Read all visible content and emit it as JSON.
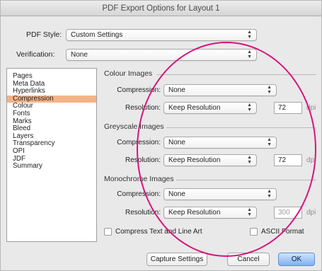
{
  "window": {
    "title": "PDF Export Options for Layout 1"
  },
  "pdf_style": {
    "label": "PDF Style:",
    "value": "Custom Settings"
  },
  "verification": {
    "label": "Verification:",
    "value": "None"
  },
  "sidebar": {
    "items": [
      {
        "label": "Pages"
      },
      {
        "label": "Meta Data"
      },
      {
        "label": "Hyperlinks"
      },
      {
        "label": "Compression",
        "selected": true
      },
      {
        "label": "Colour"
      },
      {
        "label": "Fonts"
      },
      {
        "label": "Marks"
      },
      {
        "label": "Bleed"
      },
      {
        "label": "Layers"
      },
      {
        "label": "Transparency"
      },
      {
        "label": "OPI"
      },
      {
        "label": "JDF"
      },
      {
        "label": "Summary"
      }
    ]
  },
  "colour_images": {
    "title": "Colour Images",
    "compression_label": "Compression:",
    "compression_value": "None",
    "resolution_label": "Resolution:",
    "resolution_value": "Keep Resolution",
    "dpi_value": "72",
    "dpi_unit": "dpi"
  },
  "greyscale_images": {
    "title": "Greyscale Images",
    "compression_label": "Compression:",
    "compression_value": "None",
    "resolution_label": "Resolution:",
    "resolution_value": "Keep Resolution",
    "dpi_value": "72",
    "dpi_unit": "dpi"
  },
  "monochrome_images": {
    "title": "Monochrome Images",
    "compression_label": "Compression:",
    "compression_value": "None",
    "resolution_label": "Resolution:",
    "resolution_value": "Keep Resolution",
    "dpi_value": "300",
    "dpi_unit": "dpi"
  },
  "options": {
    "compress_text_label": "Compress Text and Line Art",
    "ascii_format_label": "ASCII Format"
  },
  "buttons": {
    "capture": "Capture Settings",
    "cancel": "Cancel",
    "ok": "OK"
  },
  "colors": {
    "selection": "#f4b387",
    "annotation_circle": "#d4157e",
    "default_button": "#7fb0ef"
  }
}
